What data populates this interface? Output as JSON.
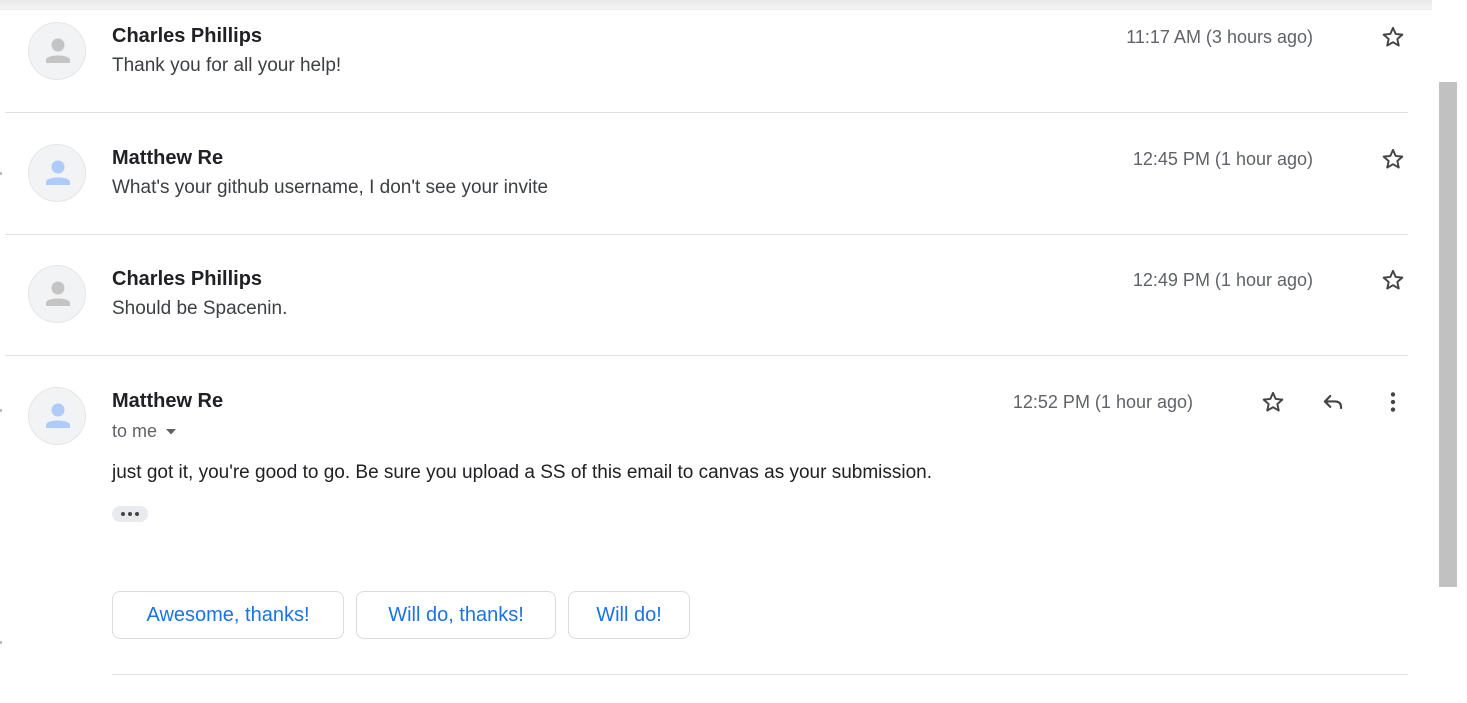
{
  "messages": [
    {
      "sender": "Charles Phillips",
      "snippet": "Thank you for all your help!",
      "time": "11:17 AM (3 hours ago)",
      "starred": false,
      "avatar": "default-person-avatar"
    },
    {
      "sender": "Matthew Re",
      "snippet": "What's your github username, I don't see your invite",
      "time": "12:45 PM (1 hour ago)",
      "starred": false,
      "avatar": "blue-person-avatar"
    },
    {
      "sender": "Charles Phillips",
      "snippet": "Should be Spacenin.",
      "time": "12:49 PM (1 hour ago)",
      "starred": false,
      "avatar": "default-person-avatar"
    }
  ],
  "open_message": {
    "sender": "Matthew Re",
    "recipient_label": "to me",
    "time": "12:52 PM (1 hour ago)",
    "body": "just got it, you're good to go. Be sure you upload a SS of this email to canvas as your submission.",
    "avatar": "blue-person-avatar",
    "actions": [
      "star-icon",
      "reply-icon",
      "more-vert-icon"
    ]
  },
  "smart_replies": [
    {
      "label": "Awesome, thanks!"
    },
    {
      "label": "Will do, thanks!"
    },
    {
      "label": "Will do!"
    }
  ],
  "colors": {
    "accent": "#1a73e8",
    "avatar_gray": "#c4c4c4",
    "avatar_blue": "#aecbfa",
    "divider": "#e0e0e0",
    "scrollbar": "#c1c1c1"
  }
}
